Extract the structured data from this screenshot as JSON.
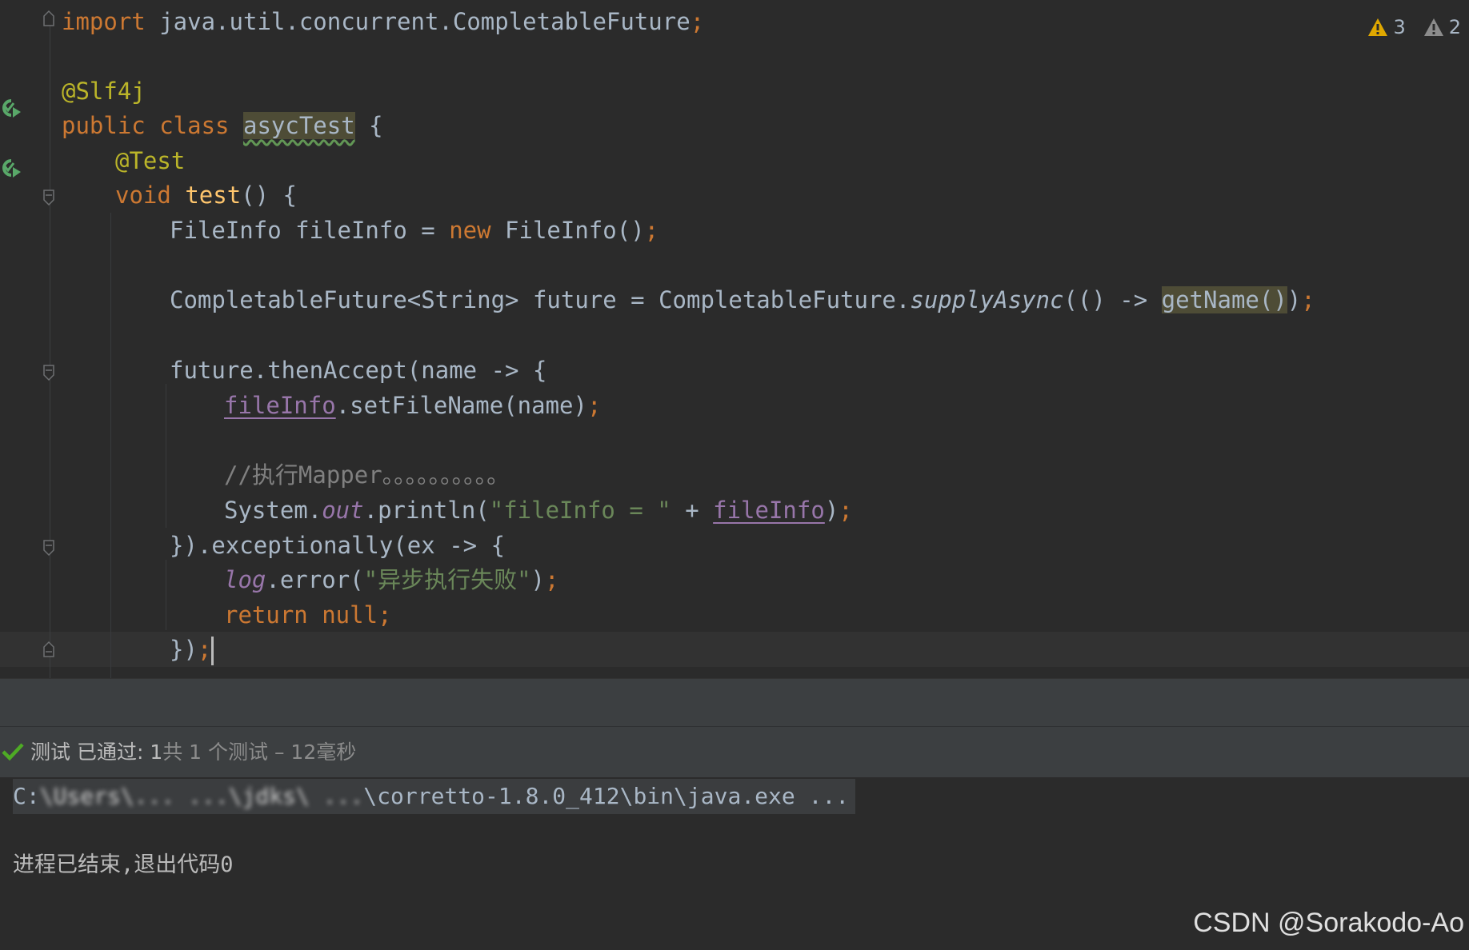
{
  "editor": {
    "inspections": {
      "warnings": "3",
      "weak_warnings": "2"
    },
    "lines": {
      "import_kw": "import",
      "import_path": " java.util.concurrent.CompletableFuture",
      "import_semi": ";",
      "slf4j": "@Slf4j",
      "public_class_kw": "public class ",
      "class_name": "asycTest",
      "class_brace": " {",
      "test_ann": "@Test",
      "void_kw": "void ",
      "test_method": "test",
      "test_sig": "() {",
      "fileinfo_decl_a": "FileInfo fileInfo = ",
      "fileinfo_new": "new",
      "fileinfo_decl_b": " FileInfo()",
      "semi": ";",
      "future_decl_a": "CompletableFuture<String> future = CompletableFuture.",
      "future_supply": "supplyAsync",
      "future_decl_b": "(() -> ",
      "future_getname": "getName()",
      "future_decl_c": ")",
      "then_accept": "future.thenAccept(name -> {",
      "set_var": "fileInfo",
      "set_call": ".setFileName(name)",
      "comment": "//执行Mapper。。。。。。。。。。",
      "println_a": "System.",
      "println_out": "out",
      "println_b": ".println(",
      "println_str": "\"fileInfo = \"",
      "println_c": " + ",
      "println_var": "fileInfo",
      "println_d": ")",
      "exceptionally": "}).exceptionally(ex -> {",
      "log_var": "log",
      "log_call": ".error(",
      "log_str": "\"异步执行失败\"",
      "log_close": ")",
      "return_stmt": "return null",
      "close_a": "})",
      "close_semi": ";"
    }
  },
  "test_results": {
    "status": "测试 已通过: 1",
    "detail": "共 1 个测试 – 12毫秒"
  },
  "console": {
    "cmd_prefix": "C:",
    "cmd_blurred": "\\Users\\... ...\\jdks\\ ...",
    "cmd_suffix": "\\corretto-1.8.0_412\\bin\\java.exe ...",
    "exit_message": "进程已结束,退出代码0"
  },
  "watermark": "CSDN @Sorakodo-Ao",
  "colors": {
    "background": "#2b2b2b",
    "keyword": "#cc7832",
    "annotation": "#bbb529",
    "method": "#ffc66d",
    "string": "#6a8759",
    "comment": "#808080",
    "field": "#9876aa",
    "pass_check": "#4eaa25"
  }
}
